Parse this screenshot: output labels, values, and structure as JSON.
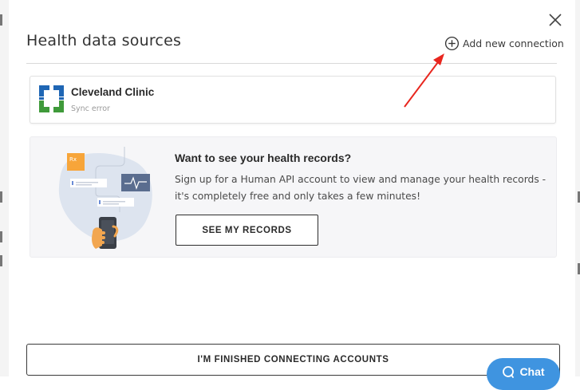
{
  "modal": {
    "title": "Health data sources",
    "add_connection_label": "Add new connection"
  },
  "sources": [
    {
      "name": "Cleveland Clinic",
      "status": "Sync error"
    }
  ],
  "promo": {
    "heading": "Want to see your health records?",
    "body": "Sign up for a Human API account to view and manage your health records - it's completely free and only takes a few minutes!",
    "button_label": "SEE MY RECORDS"
  },
  "footer": {
    "finish_label": "I'M FINISHED CONNECTING ACCOUNTS"
  },
  "chat": {
    "label": "Chat"
  },
  "icons": {
    "close": "close-icon",
    "add": "plus-circle-icon",
    "source_logo": "cleveland-clinic-logo",
    "chat": "chat-bubble-icon",
    "annotation": "red-arrow"
  },
  "colors": {
    "logo_blue": "#1f66b4",
    "logo_green": "#3f9a3a",
    "chat_blue": "#3f94e0",
    "annotation_red": "#e8261e"
  }
}
